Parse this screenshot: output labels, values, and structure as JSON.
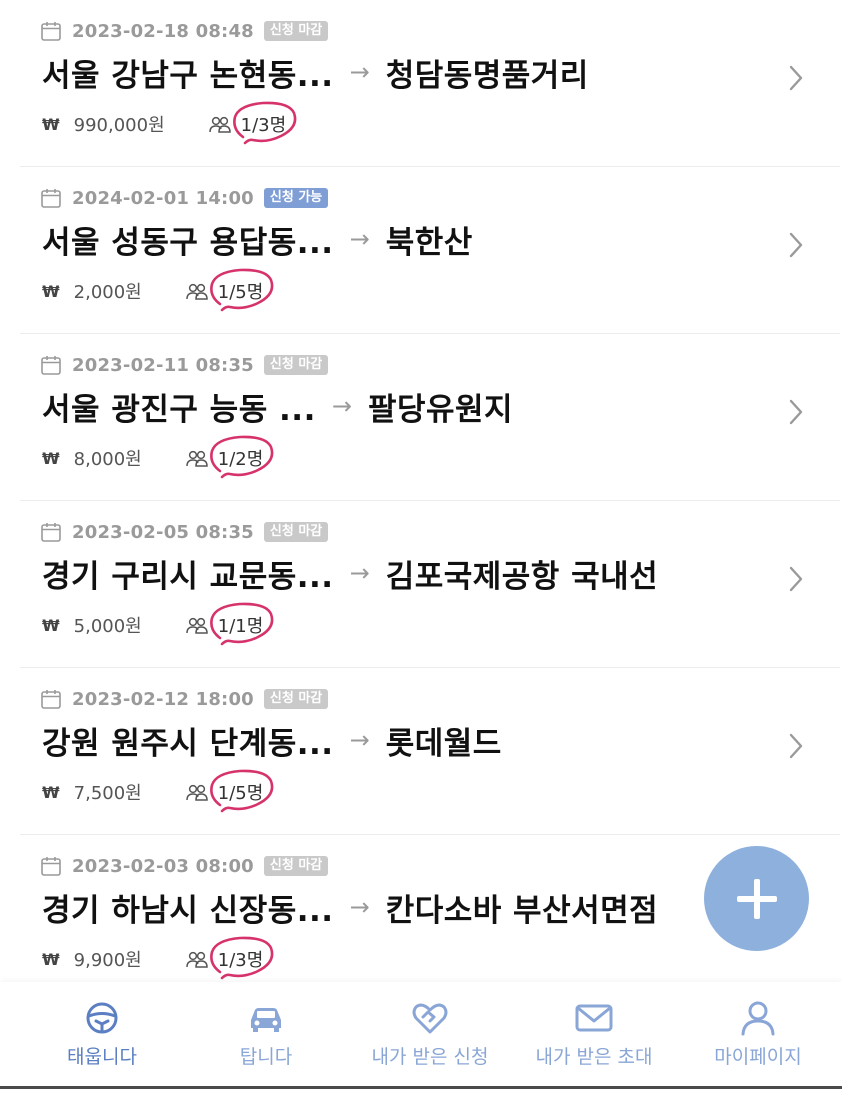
{
  "rides": [
    {
      "date": "2023-02-18 08:48",
      "status": "신청 마감",
      "status_kind": "closed",
      "from": "서울 강남구 논현동...",
      "to": "청담동명품거리",
      "currency": "₩",
      "price": "990,000원",
      "count": "1/3명"
    },
    {
      "date": "2024-02-01 14:00",
      "status": "신청 가능",
      "status_kind": "open",
      "from": "서울 성동구 용답동...",
      "to": "북한산",
      "currency": "₩",
      "price": "2,000원",
      "count": "1/5명"
    },
    {
      "date": "2023-02-11 08:35",
      "status": "신청 마감",
      "status_kind": "closed",
      "from": "서울 광진구 능동 ...",
      "to": "팔당유원지",
      "currency": "₩",
      "price": "8,000원",
      "count": "1/2명"
    },
    {
      "date": "2023-02-05 08:35",
      "status": "신청 마감",
      "status_kind": "closed",
      "from": "경기 구리시 교문동...",
      "to": "김포국제공항 국내선",
      "currency": "₩",
      "price": "5,000원",
      "count": "1/1명"
    },
    {
      "date": "2023-02-12 18:00",
      "status": "신청 마감",
      "status_kind": "closed",
      "from": "강원 원주시 단계동...",
      "to": "롯데월드",
      "currency": "₩",
      "price": "7,500원",
      "count": "1/5명"
    },
    {
      "date": "2023-02-03 08:00",
      "status": "신청 마감",
      "status_kind": "closed",
      "from": "경기 하남시 신장동...",
      "to": "칸다소바 부산서면점",
      "currency": "₩",
      "price": "9,900원",
      "count": "1/3명"
    }
  ],
  "route_arrow": "→",
  "fab": {
    "icon": "plus-icon"
  },
  "nav": [
    {
      "label": "태웁니다",
      "icon": "steering-wheel-icon",
      "active": true
    },
    {
      "label": "탑니다",
      "icon": "car-icon",
      "active": false
    },
    {
      "label": "내가 받은 신청",
      "icon": "heart-handshake-icon",
      "active": false
    },
    {
      "label": "내가 받은 초대",
      "icon": "envelope-icon",
      "active": false
    },
    {
      "label": "마이페이지",
      "icon": "person-icon",
      "active": false
    }
  ],
  "colors": {
    "accent": "#8eb0dc",
    "nav_text": "#8aa6d6",
    "badge_open": "#7f9ed6",
    "badge_closed": "#c9c9c9",
    "annotation": "#d6336c"
  }
}
